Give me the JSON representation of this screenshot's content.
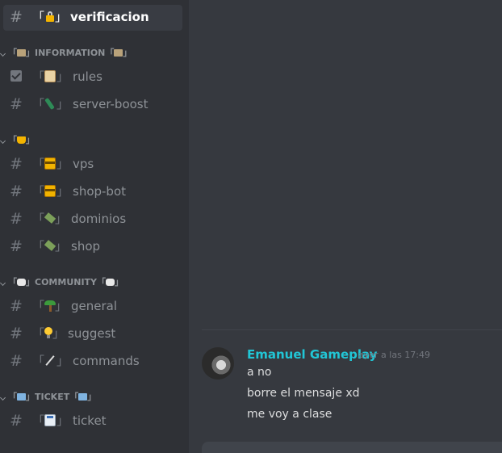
{
  "sidebar": {
    "channels": [
      {
        "id": "verificacion",
        "name": "verificacion",
        "emoji": "lock-emoji",
        "active": true
      },
      {
        "id": "rules",
        "name": "rules",
        "emoji": "scroll-emoji",
        "icon": "checkbox-icon"
      },
      {
        "id": "server-boost",
        "name": "server-boost",
        "emoji": "bottle-emoji"
      },
      {
        "id": "vps",
        "name": "vps",
        "emoji": "credit-card-emoji"
      },
      {
        "id": "shop-bot",
        "name": "shop-bot",
        "emoji": "credit-card-emoji"
      },
      {
        "id": "dominios",
        "name": "dominios",
        "emoji": "satellite-emoji"
      },
      {
        "id": "shop",
        "name": "shop",
        "emoji": "satellite-emoji"
      },
      {
        "id": "general",
        "name": "general",
        "emoji": "palm-tree-emoji"
      },
      {
        "id": "suggest",
        "name": "suggest",
        "emoji": "light-bulb-emoji"
      },
      {
        "id": "commands",
        "name": "commands",
        "emoji": "magic-wand-emoji"
      },
      {
        "id": "ticket",
        "name": "ticket",
        "emoji": "ticket-emoji"
      }
    ],
    "categories": [
      {
        "id": "information",
        "label": "INFORMATION",
        "emoji": "books-emoji"
      },
      {
        "id": "trophy",
        "label": "",
        "emoji": "trophy-emoji"
      },
      {
        "id": "community",
        "label": "COMMUNITY",
        "emoji": "speech-bubble-emoji"
      },
      {
        "id": "ticket",
        "label": "TICKET",
        "emoji": "ticket-emoji"
      }
    ],
    "bracket_open": "「",
    "bracket_close": "」",
    "hash_symbol": "#"
  },
  "chat": {
    "message": {
      "author": "Emanuel Gameplay",
      "author_color": "#21c6d6",
      "timestamp": "ayer a las 17:49",
      "lines": [
        "a no",
        "borre el mensaje xd",
        "me voy a clase"
      ]
    }
  },
  "colors": {
    "sidebar_bg": "#2f3136",
    "chat_bg": "#36393f",
    "active_channel_bg": "#393c43",
    "muted_text": "#8e9297",
    "message_text": "#dcddde"
  }
}
